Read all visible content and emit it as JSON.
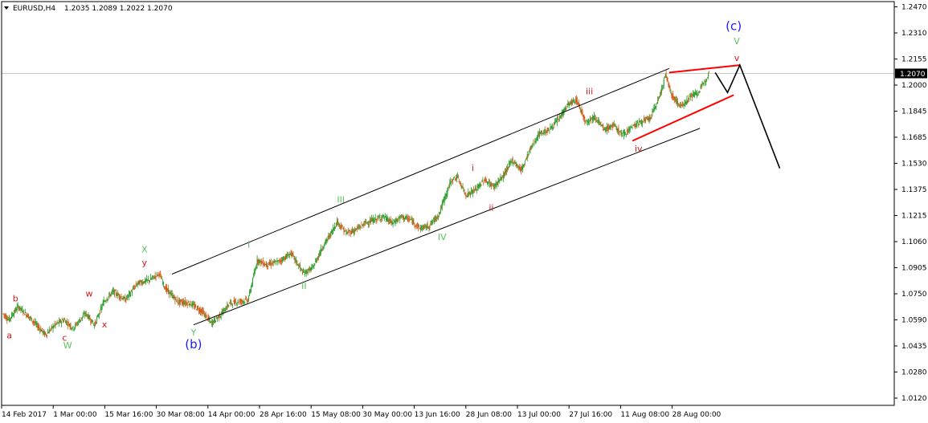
{
  "header": {
    "symbol": "EURUSD,H4",
    "ohlc": "1.2035 1.2089 1.2022 1.2070"
  },
  "colors": {
    "bull": "#2e9e2e",
    "bear": "#cc5a14",
    "wave_red": "#d01818",
    "wave_green": "#5cc05c",
    "wave_blue": "#1a1aff",
    "channel": "#000000",
    "triangle": "#ff0000",
    "price_tag": "#000000"
  },
  "chart_data": {
    "type": "candlestick",
    "symbol": "EURUSD",
    "timeframe": "H4",
    "last_price": "1.2070",
    "y_ticks": [
      "1.2470",
      "1.2310",
      "1.2155",
      "1.2000",
      "1.1845",
      "1.1685",
      "1.1530",
      "1.1375",
      "1.1215",
      "1.1060",
      "1.0905",
      "1.0750",
      "1.0590",
      "1.0435",
      "1.0280",
      "1.0120"
    ],
    "ylim": [
      1.0085,
      1.2505
    ],
    "x_ticks": [
      "14 Feb 2017",
      "1 Mar 00:00",
      "15 Mar 16:00",
      "30 Mar 08:00",
      "14 Apr 00:00",
      "28 Apr 16:00",
      "15 May 08:00",
      "30 May 00:00",
      "13 Jun 16:00",
      "28 Jun 08:00",
      "13 Jul 00:00",
      "27 Jul 16:00",
      "11 Aug 08:00",
      "28 Aug 00:00"
    ],
    "price_path": [
      [
        0,
        1.063
      ],
      [
        2,
        1.059
      ],
      [
        5,
        1.067
      ],
      [
        8,
        1.062
      ],
      [
        11,
        1.056
      ],
      [
        14,
        1.05
      ],
      [
        17,
        1.056
      ],
      [
        20,
        1.059
      ],
      [
        23,
        1.054
      ],
      [
        27,
        1.063
      ],
      [
        30,
        1.056
      ],
      [
        33,
        1.07
      ],
      [
        36,
        1.076
      ],
      [
        40,
        1.071
      ],
      [
        44,
        1.081
      ],
      [
        48,
        1.083
      ],
      [
        51,
        1.087
      ],
      [
        53,
        1.078
      ],
      [
        57,
        1.07
      ],
      [
        61,
        1.069
      ],
      [
        65,
        1.064
      ],
      [
        68,
        1.057
      ],
      [
        71,
        1.062
      ],
      [
        74,
        1.069
      ],
      [
        77,
        1.07
      ],
      [
        80,
        1.071
      ],
      [
        83,
        1.095
      ],
      [
        86,
        1.092
      ],
      [
        90,
        1.094
      ],
      [
        94,
        1.099
      ],
      [
        98,
        1.087
      ],
      [
        101,
        1.09
      ],
      [
        104,
        1.102
      ],
      [
        107,
        1.111
      ],
      [
        109,
        1.118
      ],
      [
        112,
        1.111
      ],
      [
        115,
        1.113
      ],
      [
        118,
        1.117
      ],
      [
        121,
        1.119
      ],
      [
        124,
        1.121
      ],
      [
        127,
        1.117
      ],
      [
        130,
        1.121
      ],
      [
        133,
        1.119
      ],
      [
        136,
        1.114
      ],
      [
        139,
        1.1155
      ],
      [
        142,
        1.122
      ],
      [
        144,
        1.132
      ],
      [
        146,
        1.142
      ],
      [
        148,
        1.145
      ],
      [
        151,
        1.134
      ],
      [
        154,
        1.137
      ],
      [
        157,
        1.143
      ],
      [
        160,
        1.139
      ],
      [
        163,
        1.145
      ],
      [
        166,
        1.155
      ],
      [
        169,
        1.149
      ],
      [
        172,
        1.162
      ],
      [
        175,
        1.171
      ],
      [
        178,
        1.173
      ],
      [
        181,
        1.179
      ],
      [
        184,
        1.188
      ],
      [
        187,
        1.191
      ],
      [
        190,
        1.178
      ],
      [
        193,
        1.181
      ],
      [
        196,
        1.173
      ],
      [
        199,
        1.176
      ],
      [
        202,
        1.17
      ],
      [
        205,
        1.175
      ],
      [
        208,
        1.178
      ],
      [
        211,
        1.18
      ],
      [
        214,
        1.193
      ],
      [
        216,
        1.206
      ],
      [
        218,
        1.194
      ],
      [
        221,
        1.187
      ],
      [
        224,
        1.193
      ],
      [
        227,
        1.196
      ],
      [
        230,
        1.207
      ]
    ],
    "channel_upper": [
      [
        55,
        1.0865
      ],
      [
        217,
        1.21
      ]
    ],
    "channel_lower": [
      [
        62,
        1.056
      ],
      [
        227,
        1.174
      ]
    ],
    "triangle_upper": [
      [
        217,
        1.2075
      ],
      [
        240,
        1.212
      ]
    ],
    "triangle_lower": [
      [
        205,
        1.1665
      ],
      [
        238,
        1.194
      ]
    ],
    "projection": [
      [
        232,
        1.2075
      ],
      [
        236,
        1.1955
      ],
      [
        240,
        1.212
      ],
      [
        253,
        1.15
      ]
    ],
    "wave_labels": [
      {
        "text": "a",
        "x": 2,
        "price": 1.048,
        "color": "red"
      },
      {
        "text": "b",
        "x": 4,
        "price": 1.07,
        "color": "red"
      },
      {
        "text": "c",
        "x": 20,
        "price": 1.0465,
        "color": "red"
      },
      {
        "text": "W",
        "x": 21,
        "price": 1.042,
        "color": "green"
      },
      {
        "text": "w",
        "x": 28,
        "price": 1.073,
        "color": "red"
      },
      {
        "text": "x",
        "x": 33,
        "price": 1.0545,
        "color": "red"
      },
      {
        "text": "X",
        "x": 46,
        "price": 1.0995,
        "color": "green"
      },
      {
        "text": "y",
        "x": 46,
        "price": 1.0915,
        "color": "red"
      },
      {
        "text": "Y",
        "x": 62,
        "price": 1.0495,
        "color": "green"
      },
      {
        "text": "(b)",
        "x": 62,
        "price": 1.042,
        "color": "blue"
      },
      {
        "text": "I",
        "x": 80,
        "price": 1.1025,
        "color": "green"
      },
      {
        "text": "II",
        "x": 98,
        "price": 1.0775,
        "color": "green"
      },
      {
        "text": "III",
        "x": 110,
        "price": 1.1295,
        "color": "green"
      },
      {
        "text": "IV",
        "x": 143,
        "price": 1.107,
        "color": "green"
      },
      {
        "text": "i",
        "x": 153,
        "price": 1.1485,
        "color": "red"
      },
      {
        "text": "ii",
        "x": 159,
        "price": 1.1245,
        "color": "red"
      },
      {
        "text": "iii",
        "x": 191,
        "price": 1.1945,
        "color": "red"
      },
      {
        "text": "iv",
        "x": 207,
        "price": 1.16,
        "color": "red"
      },
      {
        "text": "(c)",
        "x": 238,
        "price": 1.233,
        "color": "blue"
      },
      {
        "text": "V",
        "x": 239,
        "price": 1.2245,
        "color": "green"
      },
      {
        "text": "v",
        "x": 239,
        "price": 1.2145,
        "color": "red"
      }
    ]
  }
}
